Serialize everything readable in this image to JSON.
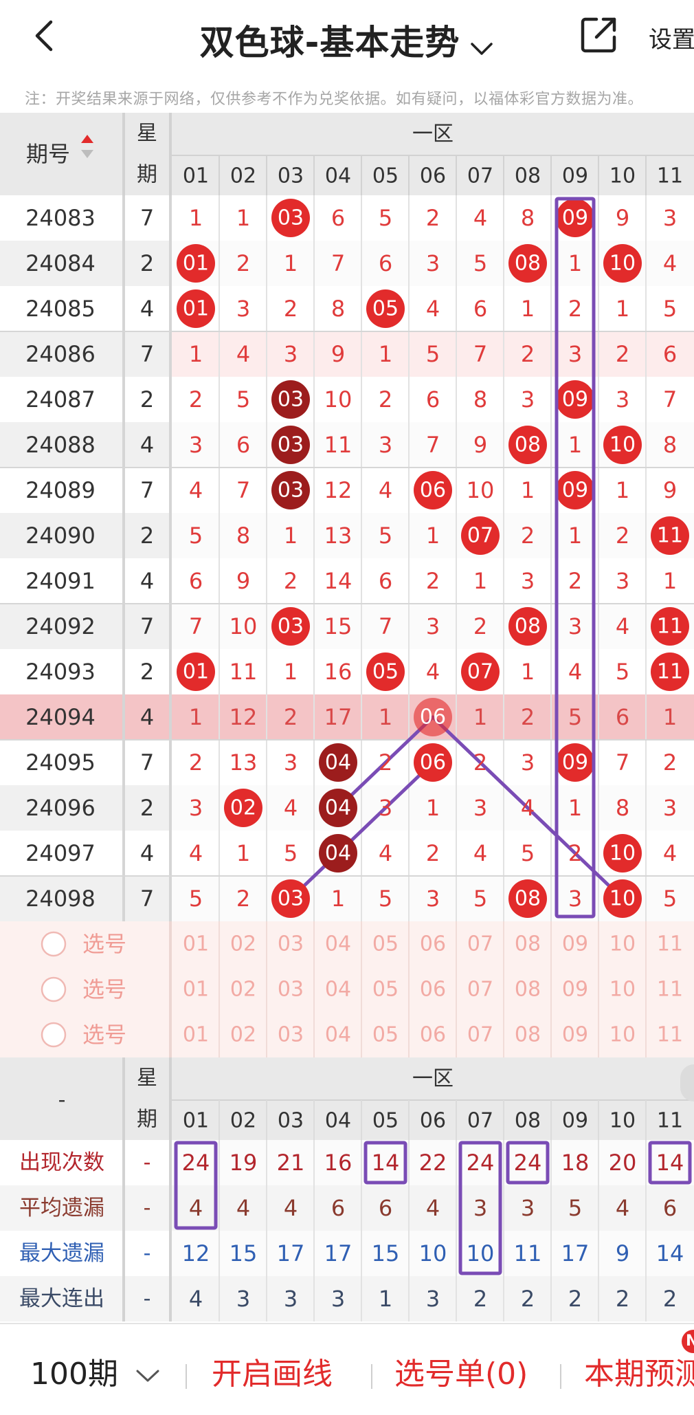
{
  "header": {
    "title": "双色球-基本走势",
    "settings_label": "设置"
  },
  "notice": "注：开奖结果来源于网络，仅供参考不作为兑奖依据。如有疑问，以福体彩官方数据为准。",
  "table": {
    "issue_header": "期号",
    "week_header": [
      "星",
      "期"
    ],
    "zone_header": "一区",
    "columns": [
      "01",
      "02",
      "03",
      "04",
      "05",
      "06",
      "07",
      "08",
      "09",
      "10",
      "11"
    ],
    "rows": [
      {
        "issue": "24083",
        "week": "7",
        "cells": [
          "1",
          "1",
          "03",
          "6",
          "5",
          "2",
          "4",
          "8",
          "09",
          "9",
          "3"
        ]
      },
      {
        "issue": "24084",
        "week": "2",
        "cells": [
          "01",
          "2",
          "1",
          "7",
          "6",
          "3",
          "5",
          "08",
          "1",
          "10",
          "4"
        ]
      },
      {
        "issue": "24085",
        "week": "4",
        "cells": [
          "01",
          "3",
          "2",
          "8",
          "05",
          "4",
          "6",
          "1",
          "2",
          "1",
          "5"
        ]
      },
      {
        "issue": "24086",
        "week": "7",
        "cells": [
          "1",
          "4",
          "3",
          "9",
          "1",
          "5",
          "7",
          "2",
          "3",
          "2",
          "6"
        ]
      },
      {
        "issue": "24087",
        "week": "2",
        "cells": [
          "2",
          "5",
          "03",
          "10",
          "2",
          "6",
          "8",
          "3",
          "09",
          "3",
          "7"
        ]
      },
      {
        "issue": "24088",
        "week": "4",
        "cells": [
          "3",
          "6",
          "03",
          "11",
          "3",
          "7",
          "9",
          "08",
          "1",
          "10",
          "8"
        ]
      },
      {
        "issue": "24089",
        "week": "7",
        "cells": [
          "4",
          "7",
          "03",
          "12",
          "4",
          "06",
          "10",
          "1",
          "09",
          "1",
          "9"
        ]
      },
      {
        "issue": "24090",
        "week": "2",
        "cells": [
          "5",
          "8",
          "1",
          "13",
          "5",
          "1",
          "07",
          "2",
          "1",
          "2",
          "11"
        ]
      },
      {
        "issue": "24091",
        "week": "4",
        "cells": [
          "6",
          "9",
          "2",
          "14",
          "6",
          "2",
          "1",
          "3",
          "2",
          "3",
          "1"
        ]
      },
      {
        "issue": "24092",
        "week": "7",
        "cells": [
          "7",
          "10",
          "03",
          "15",
          "7",
          "3",
          "2",
          "08",
          "3",
          "4",
          "11"
        ]
      },
      {
        "issue": "24093",
        "week": "2",
        "cells": [
          "01",
          "11",
          "1",
          "16",
          "05",
          "4",
          "07",
          "1",
          "4",
          "5",
          "11"
        ]
      },
      {
        "issue": "24094",
        "week": "4",
        "cells": [
          "1",
          "12",
          "2",
          "17",
          "1",
          "06",
          "1",
          "2",
          "5",
          "6",
          "1"
        ]
      },
      {
        "issue": "24095",
        "week": "7",
        "cells": [
          "2",
          "13",
          "3",
          "04",
          "2",
          "06",
          "2",
          "3",
          "09",
          "7",
          "2"
        ]
      },
      {
        "issue": "24096",
        "week": "2",
        "cells": [
          "3",
          "02",
          "4",
          "04",
          "3",
          "1",
          "3",
          "4",
          "1",
          "8",
          "3"
        ]
      },
      {
        "issue": "24097",
        "week": "4",
        "cells": [
          "4",
          "1",
          "5",
          "04",
          "4",
          "2",
          "4",
          "5",
          "2",
          "10",
          "4"
        ]
      },
      {
        "issue": "24098",
        "week": "7",
        "cells": [
          "5",
          "2",
          "03",
          "1",
          "5",
          "3",
          "5",
          "08",
          "3",
          "10",
          "5"
        ]
      }
    ],
    "ball_styles": [
      [
        "n",
        "n",
        "r",
        "n",
        "n",
        "n",
        "n",
        "n",
        "r",
        "n",
        "n"
      ],
      [
        "r",
        "n",
        "n",
        "n",
        "n",
        "n",
        "n",
        "r",
        "n",
        "r",
        "n"
      ],
      [
        "r",
        "n",
        "n",
        "n",
        "r",
        "n",
        "n",
        "n",
        "n",
        "n",
        "n"
      ],
      [
        "n",
        "n",
        "n",
        "n",
        "n",
        "n",
        "n",
        "n",
        "n",
        "n",
        "n"
      ],
      [
        "n",
        "n",
        "d",
        "n",
        "n",
        "n",
        "n",
        "n",
        "r",
        "n",
        "n"
      ],
      [
        "n",
        "n",
        "d",
        "n",
        "n",
        "n",
        "n",
        "r",
        "n",
        "r",
        "n"
      ],
      [
        "n",
        "n",
        "d",
        "n",
        "n",
        "r",
        "n",
        "n",
        "r",
        "n",
        "n"
      ],
      [
        "n",
        "n",
        "n",
        "n",
        "n",
        "n",
        "r",
        "n",
        "n",
        "n",
        "r"
      ],
      [
        "n",
        "n",
        "n",
        "n",
        "n",
        "n",
        "n",
        "n",
        "n",
        "n",
        "n"
      ],
      [
        "n",
        "n",
        "r",
        "n",
        "n",
        "n",
        "n",
        "r",
        "n",
        "n",
        "r"
      ],
      [
        "r",
        "n",
        "n",
        "n",
        "r",
        "n",
        "r",
        "n",
        "n",
        "n",
        "r"
      ],
      [
        "n",
        "n",
        "n",
        "n",
        "n",
        "r",
        "n",
        "n",
        "n",
        "n",
        "n"
      ],
      [
        "n",
        "n",
        "n",
        "d",
        "n",
        "r",
        "n",
        "n",
        "r",
        "n",
        "n"
      ],
      [
        "n",
        "r",
        "n",
        "d",
        "n",
        "n",
        "n",
        "n",
        "n",
        "n",
        "n"
      ],
      [
        "n",
        "n",
        "n",
        "d",
        "n",
        "n",
        "n",
        "n",
        "n",
        "r",
        "n"
      ],
      [
        "n",
        "n",
        "r",
        "n",
        "n",
        "n",
        "n",
        "r",
        "n",
        "r",
        "n"
      ]
    ],
    "highlighted_issue": "24094",
    "pick_rows": [
      {
        "label": "选号",
        "numbers": [
          "01",
          "02",
          "03",
          "04",
          "05",
          "06",
          "07",
          "08",
          "09",
          "10",
          "11"
        ]
      },
      {
        "label": "选号",
        "numbers": [
          "01",
          "02",
          "03",
          "04",
          "05",
          "06",
          "07",
          "08",
          "09",
          "10",
          "11"
        ]
      },
      {
        "label": "选号",
        "numbers": [
          "01",
          "02",
          "03",
          "04",
          "05",
          "06",
          "07",
          "08",
          "09",
          "10",
          "11"
        ]
      }
    ]
  },
  "stats": {
    "label_header": "-",
    "week_header": [
      "星",
      "期"
    ],
    "zone_header": "一区",
    "columns": [
      "01",
      "02",
      "03",
      "04",
      "05",
      "06",
      "07",
      "08",
      "09",
      "10",
      "11"
    ],
    "rows": [
      {
        "label": "出现次数",
        "week": "-",
        "color": "#b3262d",
        "values": [
          "24",
          "19",
          "21",
          "16",
          "14",
          "22",
          "24",
          "24",
          "18",
          "20",
          "14"
        ]
      },
      {
        "label": "平均遗漏",
        "week": "-",
        "color": "#8a3a2e",
        "values": [
          "4",
          "4",
          "4",
          "6",
          "6",
          "4",
          "3",
          "3",
          "5",
          "4",
          "6"
        ]
      },
      {
        "label": "最大遗漏",
        "week": "-",
        "color": "#2f5fb3",
        "values": [
          "12",
          "15",
          "17",
          "17",
          "15",
          "10",
          "10",
          "11",
          "17",
          "9",
          "14"
        ]
      },
      {
        "label": "最大连出",
        "week": "-",
        "color": "#3a4a66",
        "values": [
          "4",
          "3",
          "3",
          "3",
          "1",
          "3",
          "2",
          "2",
          "2",
          "2",
          "2"
        ]
      }
    ]
  },
  "colors": {
    "accent_red": "#e22b2b",
    "dark_ball": "#9c1d1d",
    "annotation_purple": "#7a4cb5",
    "highlight_row": "#f4c4c6"
  },
  "bottom_bar": {
    "periods": "100期",
    "draw_lines": "开启画线",
    "pick_list": "选号单(0)",
    "predict": "本期预测",
    "badge": "N"
  }
}
